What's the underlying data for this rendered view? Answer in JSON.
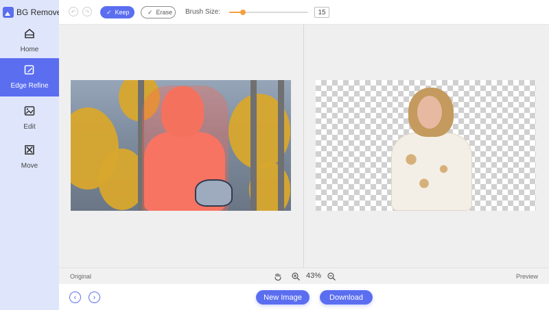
{
  "app": {
    "title": "BG Remover"
  },
  "sidebar": {
    "items": [
      {
        "label": "Home",
        "icon": "home-icon",
        "active": false
      },
      {
        "label": "Edge Refine",
        "icon": "edge-refine-icon",
        "active": true
      },
      {
        "label": "Edit",
        "icon": "image-edit-icon",
        "active": false
      },
      {
        "label": "Move",
        "icon": "move-icon",
        "active": false
      }
    ]
  },
  "toolbar": {
    "keep_label": "Keep",
    "erase_label": "Erase",
    "brush_label": "Brush Size:",
    "brush_size": "15",
    "slider_fraction": 0.17
  },
  "canvas": {
    "original_label": "Original",
    "preview_label": "Preview",
    "zoom": "43%"
  },
  "footer": {
    "new_image_label": "New Image",
    "download_label": "Download"
  },
  "colors": {
    "accent": "#5b6ef0",
    "slider": "#f2a040",
    "sidebar_bg": "#dfe6fb"
  }
}
